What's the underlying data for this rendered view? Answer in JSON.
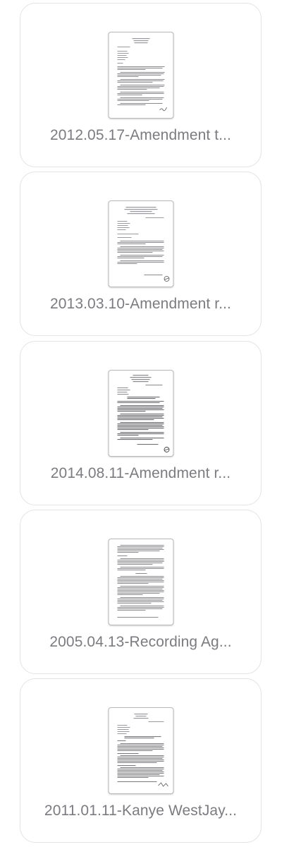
{
  "files": [
    {
      "name": "2012.05.17-Amendment t...",
      "icon": "document-thumbnail-icon"
    },
    {
      "name": "2013.03.10-Amendment r...",
      "icon": "document-thumbnail-icon"
    },
    {
      "name": "2014.08.11-Amendment r...",
      "icon": "document-thumbnail-icon"
    },
    {
      "name": "2005.04.13-Recording Ag...",
      "icon": "document-thumbnail-icon"
    },
    {
      "name": "2011.01.11-Kanye WestJay...",
      "icon": "document-thumbnail-icon"
    }
  ],
  "colors": {
    "card_border": "#e3e3e6",
    "file_name_text": "#7b7b80",
    "thumbnail_text_lines": "#8a8a8e"
  }
}
